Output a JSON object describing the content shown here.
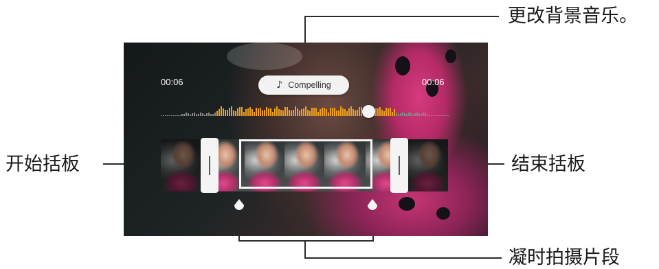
{
  "callouts": {
    "change_music": "更改背景音乐。",
    "start_bracket": "开始括板",
    "end_bracket": "结束括板",
    "hyperlapse": "凝时拍摄片段"
  },
  "editor": {
    "start_time": "00:06",
    "end_time": "00:06",
    "music_label": "Compelling",
    "music_icon": "music-note-icon",
    "playback_position": 0.73
  },
  "colors": {
    "waveform_active": "#f0a020",
    "waveform_inactive": "#8a8a8a",
    "handle": "#f4f4f4"
  }
}
